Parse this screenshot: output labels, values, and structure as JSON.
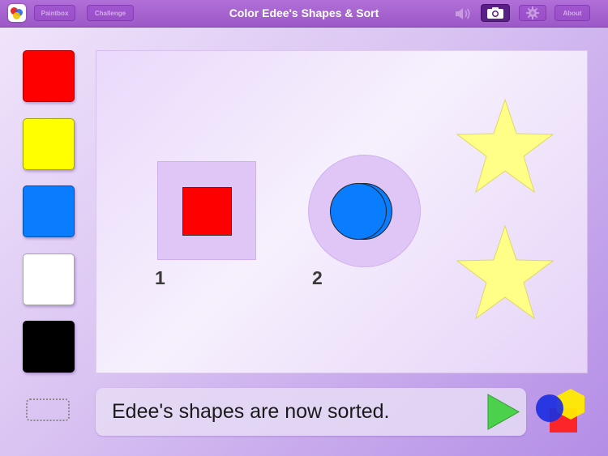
{
  "topbar": {
    "title": "Color Edee's Shapes & Sort",
    "paintbox_label": "Paintbox",
    "challenge_label": "Challenge",
    "about_label": "About"
  },
  "palette": {
    "colors": [
      "#ff0000",
      "#ffff00",
      "#0a7dff",
      "#ffffff",
      "#000000"
    ]
  },
  "canvas": {
    "slot_1_label": "1",
    "slot_2_label": "2",
    "square_color": "#ff0000",
    "circle_color": "#0a7dff",
    "star_color": "#ffff88"
  },
  "message": {
    "text": "Edee's shapes are now sorted."
  },
  "icons": {
    "app": "app-icon",
    "speaker": "speaker-icon",
    "camera": "camera-icon",
    "settings": "gear-icon",
    "play": "play-icon",
    "logo": "shapes-logo-icon"
  }
}
